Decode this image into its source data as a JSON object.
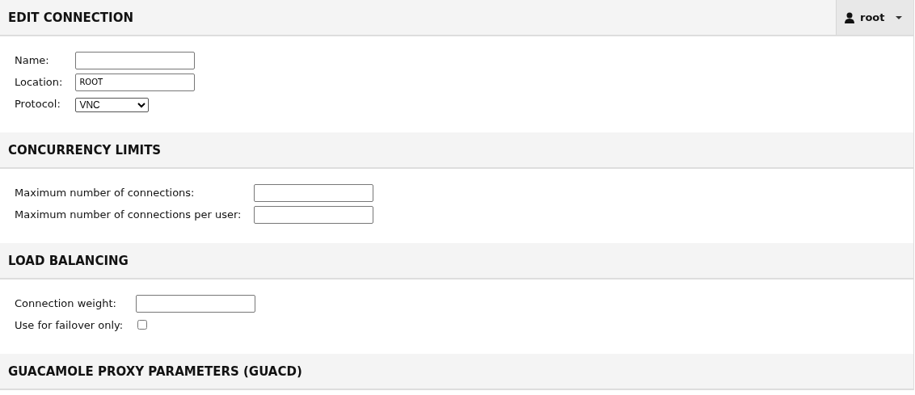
{
  "user_menu": {
    "username": "root"
  },
  "sections": [
    {
      "title": "EDIT CONNECTION",
      "fields": [
        {
          "kind": "text",
          "label": "Name:"
        },
        {
          "kind": "text",
          "label": "Location:",
          "value": "ROOT"
        },
        {
          "kind": "select",
          "label": "Protocol:",
          "value": "VNC"
        }
      ]
    },
    {
      "title": "CONCURRENCY LIMITS",
      "fields": [
        {
          "kind": "text",
          "label": "Maximum number of connections:"
        },
        {
          "kind": "text",
          "label": "Maximum number of connections per user:"
        }
      ]
    },
    {
      "title": "LOAD BALANCING",
      "fields": [
        {
          "kind": "text",
          "label": "Connection weight:"
        },
        {
          "kind": "checkbox",
          "label": "Use for failover only:",
          "checked": false
        }
      ]
    },
    {
      "title": "GUACAMOLE PROXY PARAMETERS (GUACD)"
    }
  ]
}
